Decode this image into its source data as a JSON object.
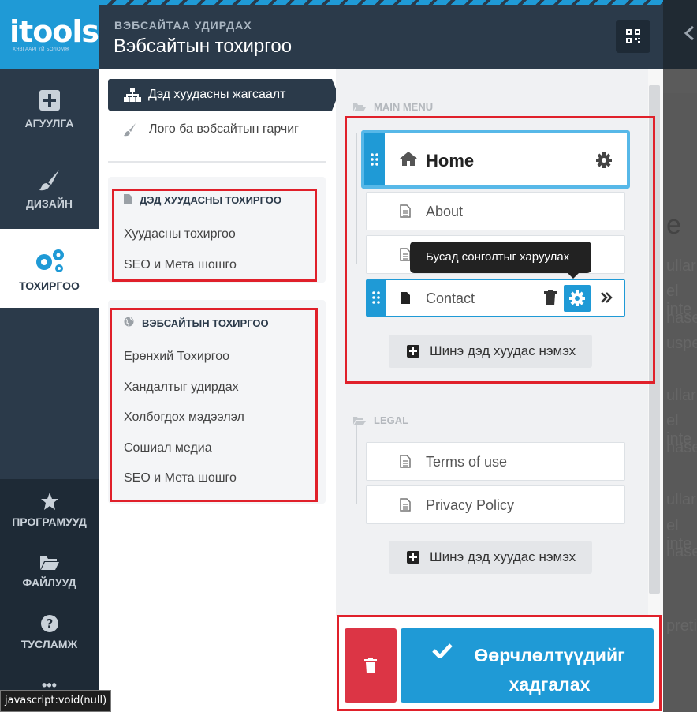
{
  "rail": {
    "logo_text": "itools",
    "logo_tagline": "ХЯЗГААРГҮЙ БОЛОМЖ",
    "items": [
      {
        "label": "АГУУЛГА",
        "icon": "plus-square-icon"
      },
      {
        "label": "ДИЗАЙН",
        "icon": "brush-icon"
      },
      {
        "label": "ТОХИРГОО",
        "icon": "gears-icon"
      },
      {
        "label": "ПРОГРАМУУД",
        "icon": "star-icon"
      },
      {
        "label": "ФАЙЛУУД",
        "icon": "folder-open-icon"
      },
      {
        "label": "ТУСЛАМЖ",
        "icon": "question-circle-icon"
      },
      {
        "label": "•••",
        "icon": "more-icon"
      }
    ]
  },
  "header": {
    "breadcrumb": "ВЭБСАЙТАА УДИРДАХ",
    "title": "Вэбсайтын тохиргоо"
  },
  "menu": {
    "active": "Дэд хуудасны жагсаалт",
    "logo_link": "Лого ба вэбсайтын гарчиг",
    "subpage_panel": {
      "title": "ДЭД ХУУДАСНЫ ТОХИРГОО",
      "links": [
        "Хуудасны тохиргоо",
        "SEO и Мета шошго"
      ]
    },
    "website_panel": {
      "title": "ВЭБСАЙТЫН ТОХИРГОО",
      "links": [
        "Ерөнхий Тохиргоо",
        "Хандалтыг удирдах",
        "Холбогдох мэдээлэл",
        "Сошиал медиа",
        "SEO и Мета шошго"
      ]
    }
  },
  "pages": {
    "main_menu_label": "MAIN MENU",
    "main_items": [
      "Home",
      "About",
      "",
      "Contact"
    ],
    "add_label": "Шинэ дэд хуудас нэмэх",
    "legal_label": "LEGAL",
    "legal_items": [
      "Terms of use",
      "Privacy Policy"
    ],
    "tooltip": "Бусад сонголтыг харуулах"
  },
  "footer": {
    "save_label": "Өөрчлөлтүүдийг хадгалах"
  },
  "status_bar": "javascript:void(null)",
  "background_fragments": [
    "e",
    "ullar",
    "el inte",
    "hase",
    "usper",
    "ullar",
    "el inte",
    "hase",
    "ullar",
    "el inte",
    "hase",
    "preti"
  ],
  "colors": {
    "accent": "#1f9ad6",
    "sidebar": "#2b3a4a",
    "danger": "#dc3545",
    "highlight": "#e0202a"
  }
}
